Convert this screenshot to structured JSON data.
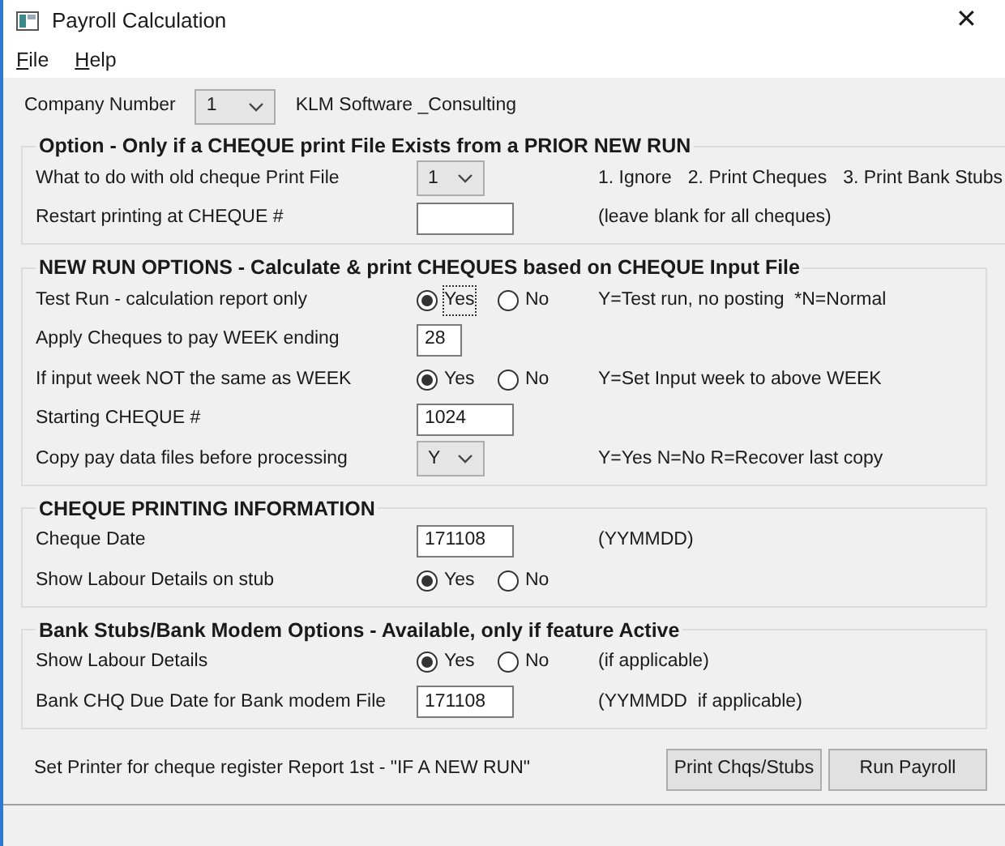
{
  "window": {
    "title": "Payroll Calculation",
    "close": "✕"
  },
  "menu": [
    {
      "label": "File"
    },
    {
      "label": "Help"
    }
  ],
  "company": {
    "label": "Company Number",
    "value": "1",
    "name": "KLM Software _Consulting"
  },
  "groups": [
    {
      "title": "Option - Only if a CHEQUE print File Exists from a PRIOR NEW RUN",
      "rows": [
        {
          "kind": "select",
          "label": "What to do with old cheque Print File",
          "value": "1",
          "notes": [
            "1. Ignore",
            "2. Print Cheques",
            "3. Print Bank Stubs"
          ]
        },
        {
          "kind": "input",
          "label": "Restart printing at CHEQUE #",
          "notes": [
            "(leave blank for all cheques)"
          ]
        }
      ]
    },
    {
      "title": "NEW RUN OPTIONS - Calculate & print CHEQUES based on CHEQUE Input File",
      "rows": [
        {
          "kind": "radio",
          "label": "Test Run - calculation report only",
          "options": [
            {
              "label": "Yes",
              "selected": true,
              "focused": true
            },
            {
              "label": "No",
              "selected": false,
              "focused": false
            }
          ],
          "notes": [
            "Y=Test run, no posting  *N=Normal"
          ]
        },
        {
          "kind": "short_input",
          "label": "Apply Cheques to pay WEEK ending",
          "value": "28"
        },
        {
          "kind": "radio",
          "label": "If input week NOT the same as WEEK",
          "options": [
            {
              "label": "Yes",
              "selected": true,
              "focused": false
            },
            {
              "label": "No",
              "selected": false,
              "focused": false
            }
          ],
          "notes": [
            "Y=Set Input week to above WEEK"
          ]
        },
        {
          "kind": "input",
          "label": "Starting CHEQUE #",
          "value": "1024"
        },
        {
          "kind": "select",
          "label": "Copy pay data files before processing",
          "value": "Y",
          "notes": [
            "Y=Yes N=No R=Recover last copy"
          ]
        }
      ]
    },
    {
      "title": "CHEQUE PRINTING INFORMATION",
      "rows": [
        {
          "kind": "input",
          "label": "Cheque Date",
          "value": "171108",
          "notes": [
            "(YYMMDD)"
          ]
        },
        {
          "kind": "radio",
          "label": "Show Labour Details on stub",
          "options": [
            {
              "label": "Yes",
              "selected": true,
              "focused": false
            },
            {
              "label": "No",
              "selected": false,
              "focused": false
            }
          ]
        }
      ]
    },
    {
      "title": "Bank Stubs/Bank Modem Options - Available, only if feature Active",
      "rows": [
        {
          "kind": "radio",
          "label": "Show Labour Details",
          "options": [
            {
              "label": "Yes",
              "selected": true,
              "focused": false
            },
            {
              "label": "No",
              "selected": false,
              "focused": false
            }
          ],
          "notes": [
            "(if applicable)"
          ]
        },
        {
          "kind": "input",
          "label": "Bank CHQ Due Date for Bank modem File",
          "value": "171108",
          "notes": [
            "(YYMMDD  if applicable)"
          ]
        }
      ]
    }
  ],
  "footer": {
    "text": "Set Printer for cheque register Report 1st - \"IF A NEW RUN\"",
    "buttons": [
      "Print Chqs/Stubs",
      "Run Payroll"
    ]
  }
}
